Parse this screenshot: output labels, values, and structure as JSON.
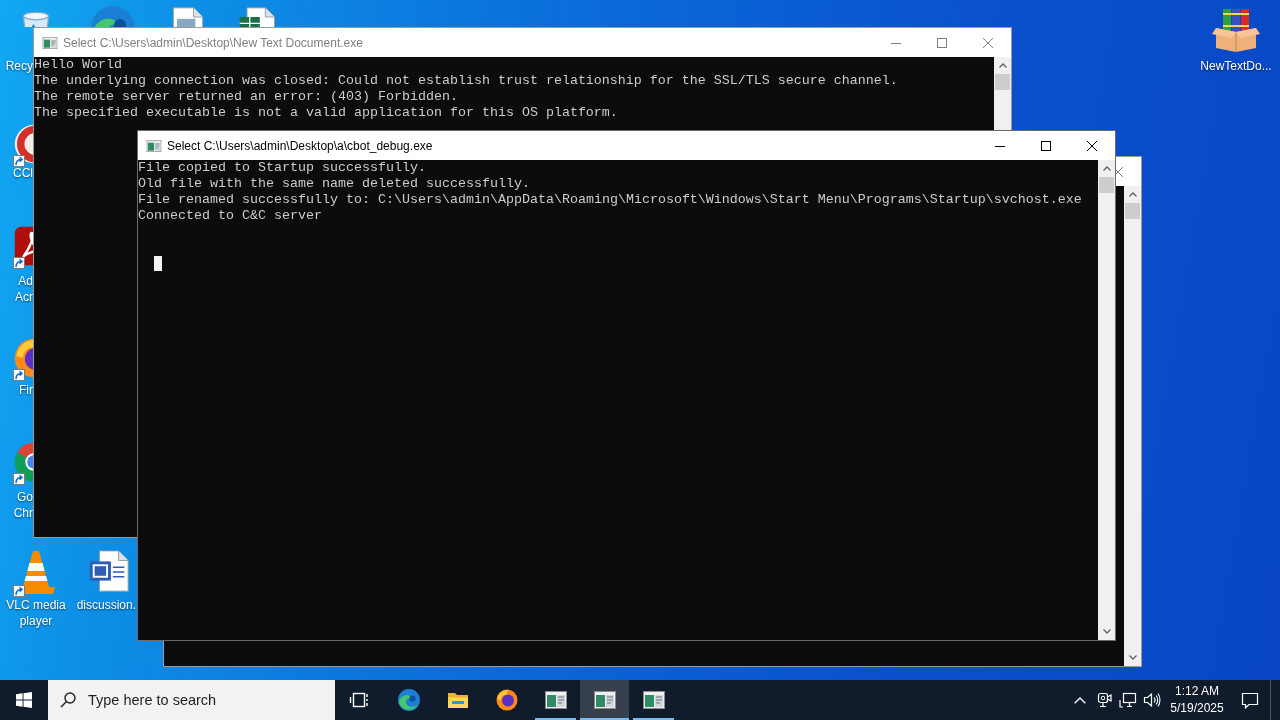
{
  "desktop": {
    "icons": [
      {
        "kind": "recycle-bin",
        "shortcut": false,
        "label_lines": [
          "Recy"
        ]
      },
      {
        "kind": "edge"
      },
      {
        "kind": "text-document"
      },
      {
        "kind": "spreadsheet"
      },
      {
        "kind": "cleaner",
        "shortcut": true,
        "label_lines": [
          "CCl"
        ]
      },
      {
        "kind": "pdf",
        "shortcut": true,
        "label_lines": [
          "Ad",
          "Acr"
        ]
      },
      {
        "kind": "firefox",
        "shortcut": true,
        "label_lines": [
          "Fir"
        ]
      },
      {
        "kind": "chrome",
        "shortcut": true,
        "label_lines": [
          "Go",
          "Chr"
        ]
      },
      {
        "kind": "vlc",
        "shortcut": true,
        "label_lines": [
          "VLC media",
          "player"
        ]
      },
      {
        "kind": "word",
        "shortcut": false,
        "label_lines": [
          "discussion."
        ]
      },
      {
        "kind": "archive",
        "shortcut": false,
        "label_lines": [
          "NewTextDo..."
        ]
      }
    ]
  },
  "windows": [
    {
      "title": "Select C:\\Users\\admin\\Desktop\\New Text Document.exe",
      "active": false,
      "lines": [
        "Hello World",
        "The underlying connection was closed: Could not establish trust relationship for the SSL/TLS secure channel.",
        "The remote server returned an error: (403) Forbidden.",
        "The specified executable is not a valid application for this OS platform."
      ]
    },
    {
      "title": "Select C:\\Users\\admin\\Desktop\\a\\cbot_debug.exe",
      "active": true,
      "cursor": true,
      "lines": [
        "File copied to Startup successfully.",
        "Old file with the same name deleted successfully.",
        "File renamed successfully to: C:\\Users\\admin\\AppData\\Roaming\\Microsoft\\Windows\\Start Menu\\Programs\\Startup\\svchost.exe",
        "Connected to C&C server"
      ]
    },
    {
      "active": false
    }
  ],
  "taskbar": {
    "search": {
      "placeholder": "Type here to search"
    },
    "apps": [
      {
        "kind": "task-view",
        "running": false,
        "selected": false
      },
      {
        "kind": "edge",
        "running": false,
        "selected": false
      },
      {
        "kind": "explorer",
        "running": false,
        "selected": false
      },
      {
        "kind": "firefox",
        "running": false,
        "selected": false
      },
      {
        "kind": "console",
        "running": true,
        "selected": false
      },
      {
        "kind": "console",
        "running": true,
        "selected": true
      },
      {
        "kind": "console",
        "running": true,
        "selected": false
      }
    ],
    "clock": {
      "time": "1:12 AM",
      "date": "5/19/2025"
    }
  }
}
